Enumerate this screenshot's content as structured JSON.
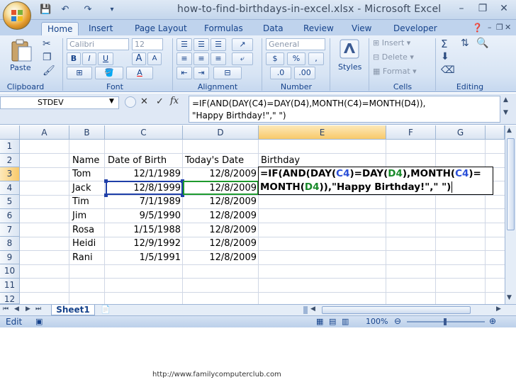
{
  "window": {
    "title": "how-to-find-birthdays-in-excel.xlsx - Microsoft Excel",
    "minimize": "–",
    "restore": "❐",
    "close": "✕"
  },
  "quick_access": {
    "save": "💾",
    "undo": "↶",
    "redo": "↷",
    "customize": "▾"
  },
  "tabs": [
    "Home",
    "Insert",
    "Page Layout",
    "Formulas",
    "Data",
    "Review",
    "View",
    "Developer"
  ],
  "ribbon": {
    "clipboard": {
      "label": "Clipboard",
      "paste": "Paste"
    },
    "font": {
      "label": "Font",
      "name": "Calibri",
      "size": "12",
      "bold": "B",
      "italic": "I",
      "underline": "U",
      "grow": "A",
      "shrink": "A"
    },
    "alignment": {
      "label": "Alignment"
    },
    "number": {
      "label": "Number",
      "format": "General",
      "currency": "$",
      "percent": "%",
      "comma": ","
    },
    "styles": {
      "label": "Styles"
    },
    "cells": {
      "label": "Cells",
      "insert": "Insert",
      "delete": "Delete",
      "format": "Format"
    },
    "editing": {
      "label": "Editing",
      "sum": "Σ"
    }
  },
  "formula_bar": {
    "name_box": "STDEV",
    "fx": "fx",
    "formula_line1": "=IF(AND(DAY(C4)=DAY(D4),MONTH(C4)=MONTH(D4)),",
    "formula_line2": "\"Happy Birthday!\",\" \")"
  },
  "grid": {
    "columns": [
      "A",
      "B",
      "C",
      "D",
      "E",
      "F",
      "G"
    ],
    "rows": [
      "1",
      "2",
      "3",
      "4",
      "5",
      "6",
      "7",
      "8",
      "9",
      "10",
      "11",
      "12"
    ],
    "headers": {
      "name": "Name",
      "dob": "Date of Birth",
      "today": "Today's Date",
      "birthday": "Birthday"
    },
    "people": [
      {
        "name": "Tom",
        "dob": "12/1/1989",
        "today": "12/8/2009"
      },
      {
        "name": "Jack",
        "dob": "12/8/1999",
        "today": "12/8/2009"
      },
      {
        "name": "Tim",
        "dob": "7/1/1989",
        "today": "12/8/2009"
      },
      {
        "name": "Jim",
        "dob": "9/5/1990",
        "today": "12/8/2009"
      },
      {
        "name": "Rosa",
        "dob": "1/15/1988",
        "today": "12/8/2009"
      },
      {
        "name": "Heidi",
        "dob": "12/9/1992",
        "today": "12/8/2009"
      },
      {
        "name": "Rani",
        "dob": "1/5/1991",
        "today": "12/8/2009"
      }
    ],
    "edit_line1": {
      "p1": "=IF(AND(DAY(",
      "r1": "C4",
      "p2": ")=DAY(",
      "r2": "D4",
      "p3": "),MONTH(",
      "r3": "C4",
      "p4": ")="
    },
    "edit_line2": {
      "p1": "MONTH(",
      "r1": "D4",
      "p2": ")),\"Happy Birthday!\",\" \")"
    }
  },
  "sheet_tabs": {
    "active": "Sheet1"
  },
  "status": {
    "mode": "Edit",
    "zoom": "100%"
  },
  "footer_url": "http://www.familycomputerclub.com"
}
